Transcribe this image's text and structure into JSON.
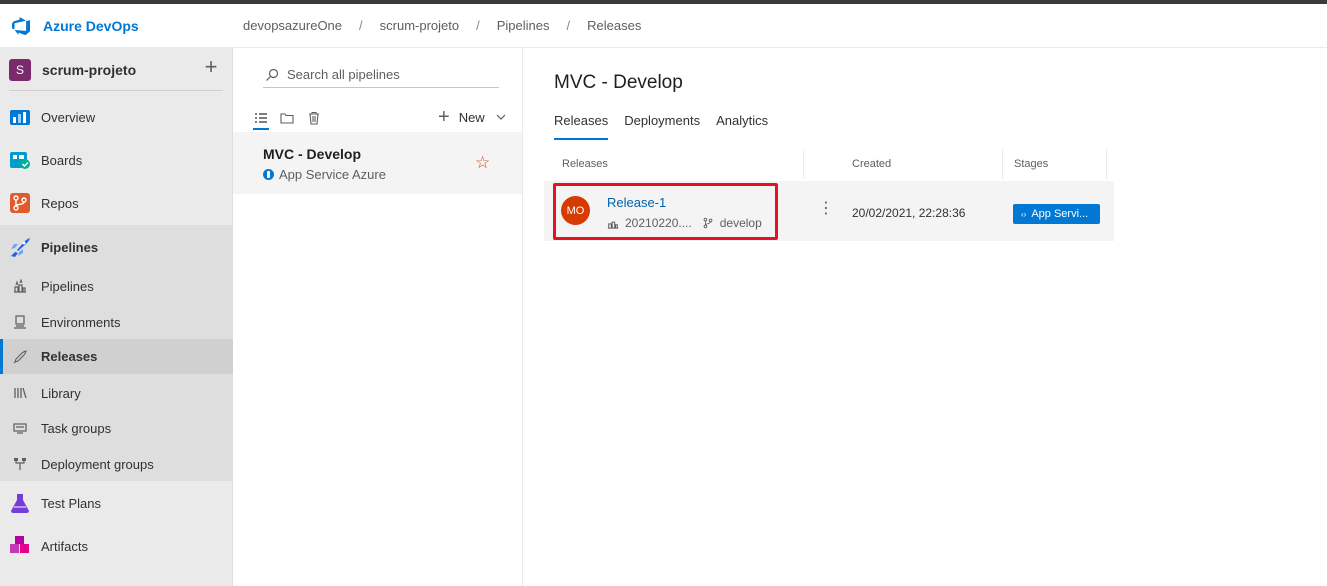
{
  "header": {
    "brand": "Azure DevOps",
    "breadcrumb": [
      "devopsazureOne",
      "scrum-projeto",
      "Pipelines",
      "Releases"
    ]
  },
  "project": {
    "initial": "S",
    "name": "scrum-projeto"
  },
  "nav": {
    "items": [
      {
        "label": "Overview",
        "icon": "overview-icon"
      },
      {
        "label": "Boards",
        "icon": "boards-icon"
      },
      {
        "label": "Repos",
        "icon": "repos-icon"
      },
      {
        "label": "Pipelines",
        "icon": "pipelines-icon"
      }
    ],
    "sub_items": [
      {
        "label": "Pipelines",
        "icon": "pipelines-sub-icon"
      },
      {
        "label": "Environments",
        "icon": "environments-icon"
      },
      {
        "label": "Releases",
        "icon": "rocket-icon"
      },
      {
        "label": "Library",
        "icon": "library-icon"
      },
      {
        "label": "Task groups",
        "icon": "task-groups-icon"
      },
      {
        "label": "Deployment groups",
        "icon": "deployment-groups-icon"
      }
    ],
    "bottom_items": [
      {
        "label": "Test Plans",
        "icon": "test-plans-icon"
      },
      {
        "label": "Artifacts",
        "icon": "artifacts-icon"
      }
    ]
  },
  "midpane": {
    "search_placeholder": "Search all pipelines",
    "new_label": "New",
    "pipeline": {
      "title": "MVC - Develop",
      "subtitle": "App Service Azure"
    }
  },
  "main": {
    "title": "MVC - Develop",
    "tabs": [
      "Releases",
      "Deployments",
      "Analytics"
    ],
    "columns": [
      "Releases",
      "Created",
      "Stages"
    ],
    "release": {
      "avatar": "MO",
      "name": "Release-1",
      "build": "20210220....",
      "branch": "develop",
      "created": "20/02/2021, 22:28:36",
      "stage": "App Servi..."
    }
  },
  "colors": {
    "accent": "#0078d4",
    "highlight": "#e81123",
    "avatar": "#d83b01",
    "project": "#7a2b6e"
  }
}
